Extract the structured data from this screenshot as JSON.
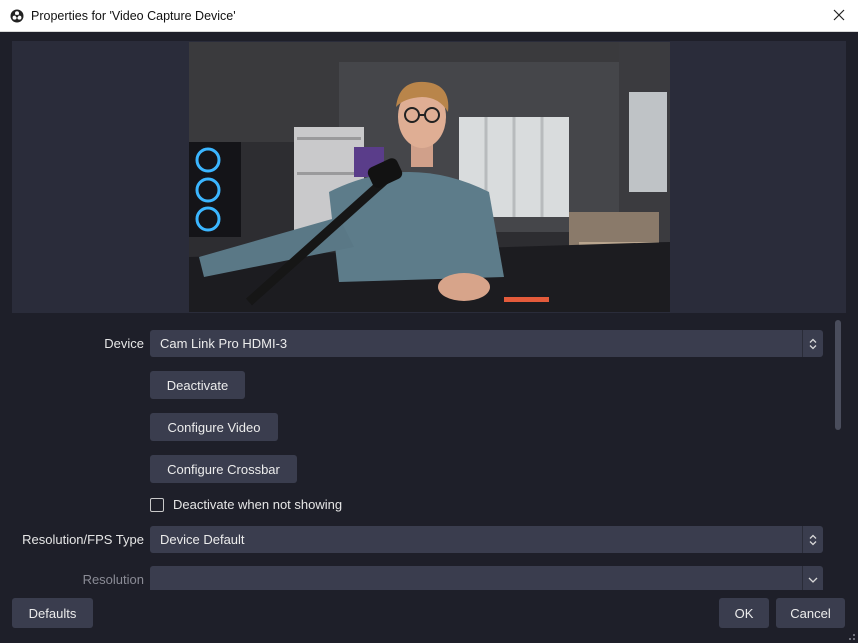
{
  "window": {
    "title": "Properties for 'Video Capture Device'",
    "icon": "obs-logo-icon"
  },
  "preview": {
    "description_icon": "camera-preview"
  },
  "properties": {
    "device": {
      "label": "Device",
      "value": "Cam Link Pro HDMI-3"
    },
    "deactivate_label": "Deactivate",
    "configure_video_label": "Configure Video",
    "configure_crossbar_label": "Configure Crossbar",
    "deactivate_when_not_showing": {
      "label": "Deactivate when not showing",
      "checked": false
    },
    "resolution_fps_type": {
      "label": "Resolution/FPS Type",
      "value": "Device Default"
    },
    "resolution": {
      "label": "Resolution",
      "value": ""
    }
  },
  "footer": {
    "defaults_label": "Defaults",
    "ok_label": "OK",
    "cancel_label": "Cancel"
  },
  "colors": {
    "background": "#1e1f29",
    "control": "#3a3d4e",
    "preview_bg": "#2a2c3a",
    "titlebar": "#ffffff"
  }
}
